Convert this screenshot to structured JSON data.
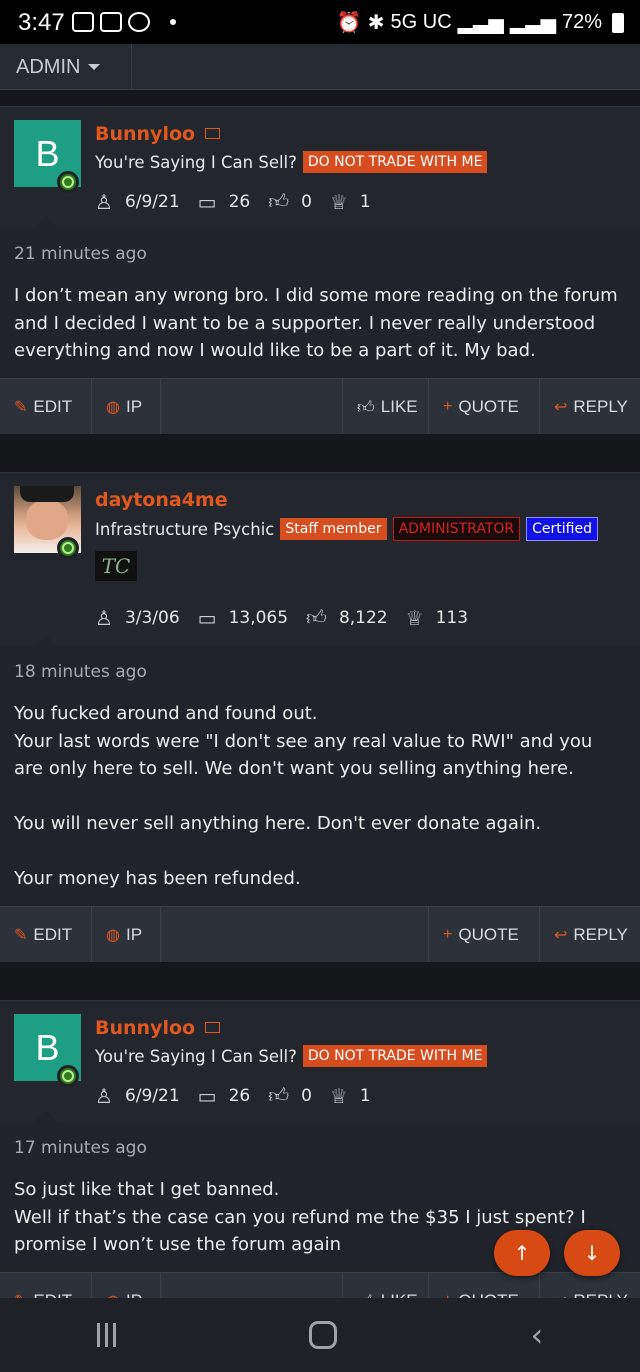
{
  "status_bar": {
    "time": "3:47",
    "network": "5G UC",
    "battery": "72%"
  },
  "admin_bar": {
    "label": "ADMIN"
  },
  "posts": [
    {
      "avatar_letter": "B",
      "username": "Bunnyloo",
      "user_title": "You're Saying I Can Sell?",
      "banner": "DO NOT TRADE WITH ME",
      "joined": "6/9/21",
      "messages": "26",
      "reactions": "0",
      "points": "1",
      "time_ago": "21 minutes ago",
      "body": "I don’t mean any wrong bro. I did some more reading on the forum and I decided I want to be a supporter. I never really understood everything and now I would like to be a part of it. My bad."
    },
    {
      "username": "daytona4me",
      "user_title": "Infrastructure Psychic",
      "badge_staff": "Staff member",
      "badge_admin": "ADMINISTRATOR",
      "badge_cert": "Certified",
      "logo_text": "TC",
      "joined": "3/3/06",
      "messages": "13,065",
      "reactions": "8,122",
      "points": "113",
      "time_ago": "18 minutes ago",
      "body": "You fucked around and found out.\nYour last words were \"I don't see any real value to RWI\" and you are only here to sell. We don't want you selling anything here.\n\nYou will never sell anything here. Don't ever donate again.\n\nYour money has been refunded."
    },
    {
      "avatar_letter": "B",
      "username": "Bunnyloo",
      "user_title": "You're Saying I Can Sell?",
      "banner": "DO NOT TRADE WITH ME",
      "joined": "6/9/21",
      "messages": "26",
      "reactions": "0",
      "points": "1",
      "time_ago": "17 minutes ago",
      "body": "So just like that I get banned.\nWell if that’s the case can you refund me the $35 I just spent? I promise I won’t use the forum again"
    }
  ],
  "actions": {
    "edit": "EDIT",
    "ip": "IP",
    "like": "LIKE",
    "quote": "QUOTE",
    "reply": "REPLY"
  },
  "colors": {
    "accent": "#e0571f",
    "background": "#202329",
    "action_bar": "#2c313a"
  }
}
